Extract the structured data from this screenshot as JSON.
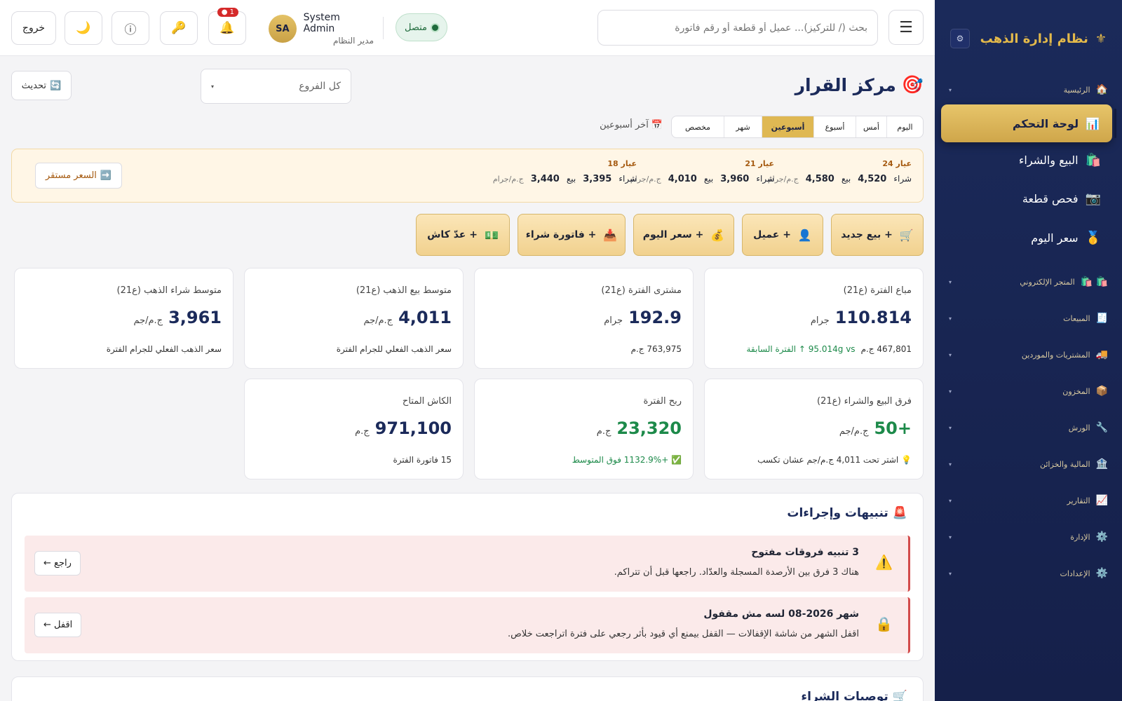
{
  "sidebar": {
    "brand": {
      "title": "نظام إدارة الذهب",
      "icon": "⚜",
      "settings_icon": "⚙"
    },
    "home": {
      "label": "الرئيسية",
      "icon": "🏠",
      "caret": "▾"
    },
    "active": {
      "label": "لوحة التحكم",
      "icon": "📊"
    },
    "big_items": [
      {
        "label": "البيع والشراء",
        "icon": "🛍️"
      },
      {
        "label": "فحص قطعة",
        "icon": "📷"
      },
      {
        "label": "سعر اليوم",
        "icon": "🥇"
      }
    ],
    "groups": [
      {
        "label": "المتجر الإلكتروني",
        "icon": "🛍️ 🛍️"
      },
      {
        "label": "المبيعات",
        "icon": "🧾"
      },
      {
        "label": "المشتريات والموردين",
        "icon": "🚚"
      },
      {
        "label": "المخزون",
        "icon": "📦"
      },
      {
        "label": "الورش",
        "icon": "🔧"
      },
      {
        "label": "المالية والخزائن",
        "icon": "🏦"
      },
      {
        "label": "التقارير",
        "icon": "📈"
      },
      {
        "label": "الإدارة",
        "icon": "⚙️"
      },
      {
        "label": "الإعدادات",
        "icon": "⚙️"
      }
    ],
    "caret": "▾"
  },
  "topbar": {
    "menu_icon": "☰",
    "search_placeholder": "بحث (/ للتركيز)... عميل أو قطعة أو رقم فاتورة",
    "status": "متصل",
    "user_name": "System Admin",
    "user_role": "مدير النظام",
    "avatar": "SA",
    "notifications_count": "1 ●",
    "bell_icon": "🔔",
    "key_icon": "🔑",
    "info_icon": "ⓘ",
    "moon_icon": "🌙",
    "logout": "خروج"
  },
  "main": {
    "title": "مركز القرار",
    "title_icon": "🎯",
    "branch": "كل الفروع",
    "branch_caret": "▾",
    "refresh": "تحديث",
    "refresh_icon": "🔄",
    "period_tabs": [
      "اليوم",
      "أمس",
      "أسبوع",
      "أسبوعين",
      "شهر",
      "مخصص"
    ],
    "period_active": "أسبوعين",
    "period_label": "آخر أسبوعين",
    "period_icon": "📅",
    "prices": [
      {
        "karat": "عيار 24",
        "buy_label": "شراء",
        "buy": "4,520",
        "sell_label": "بيع",
        "sell": "4,580",
        "unit": "ج.م/جرام"
      },
      {
        "karat": "عيار 21",
        "buy_label": "شراء",
        "buy": "3,960",
        "sell_label": "بيع",
        "sell": "4,010",
        "unit": "ج.م/جرام"
      },
      {
        "karat": "عيار 18",
        "buy_label": "شراء",
        "buy": "3,395",
        "sell_label": "بيع",
        "sell": "3,440",
        "unit": "ج.م/جرام"
      }
    ],
    "stable_price": "السعر مستقر",
    "stable_icon": "➡️",
    "actions": [
      {
        "label": "+ بيع جديد",
        "icon": "🛒"
      },
      {
        "label": "+ عميل",
        "icon": "👤"
      },
      {
        "label": "+ سعر اليوم",
        "icon": "💰"
      },
      {
        "label": "+ فاتورة شراء",
        "icon": "📥"
      },
      {
        "label": "+ عدّ كاش",
        "icon": "💵"
      }
    ],
    "cards": [
      {
        "title": "مباع الفترة (ع21)",
        "value": "110.814",
        "unit": "جرام",
        "sub": "467,801 ج.م",
        "sub_ok": "95.014g vs ↑ الفترة السابقة"
      },
      {
        "title": "مشترى الفترة (ع21)",
        "value": "192.9",
        "unit": "جرام",
        "sub": "763,975 ج.م",
        "sub_ok": ""
      },
      {
        "title": "متوسط بيع الذهب (ع21)",
        "value": "4,011",
        "unit": "ج.م/جم",
        "sub": "سعر الذهب الفعلي للجرام الفترة",
        "sub_ok": ""
      },
      {
        "title": "متوسط شراء الذهب (ع21)",
        "value": "3,961",
        "unit": "ج.م/جم",
        "sub": "سعر الذهب الفعلي للجرام الفترة",
        "sub_ok": ""
      },
      {
        "title": "فرق البيع والشراء (ع21)",
        "value": "+50",
        "unit": "ج.م/جم",
        "sub": "💡 اشتر تحت 4,011 ج.م/جم عشان تكسب",
        "sub_ok": ""
      },
      {
        "title": "ربح الفترة",
        "value": "23,320",
        "unit": "ج.م",
        "sub": "",
        "sub_ok": "✅ +1132.9% فوق المتوسط"
      },
      {
        "title": "الكاش المتاح",
        "value": "971,100",
        "unit": "ج.م",
        "sub": "15 فاتورة الفترة",
        "sub_ok": ""
      }
    ],
    "alerts_title": "تنبيهات وإجراءات",
    "alerts_icon": "🚨",
    "alerts": [
      {
        "icon": "⚠️",
        "title": "3 تنبيه فروقات مفتوح",
        "body": "هناك 3 فرق بين الأرصدة المسجلة والعدّاد. راجعها قبل أن تتراكم.",
        "button": "راجع ←"
      },
      {
        "icon": "🔒",
        "title": "شهر 2026-08 لسه مش مقفول",
        "body": "اقفل الشهر من شاشة الإقفالات — القفل بيمنع أي قيود بأثر رجعي على فترة اتراجعت خلاص.",
        "button": "اقفل ←"
      }
    ],
    "bottom_title": "توصيات الشراء",
    "bottom_icon": "🛒"
  }
}
